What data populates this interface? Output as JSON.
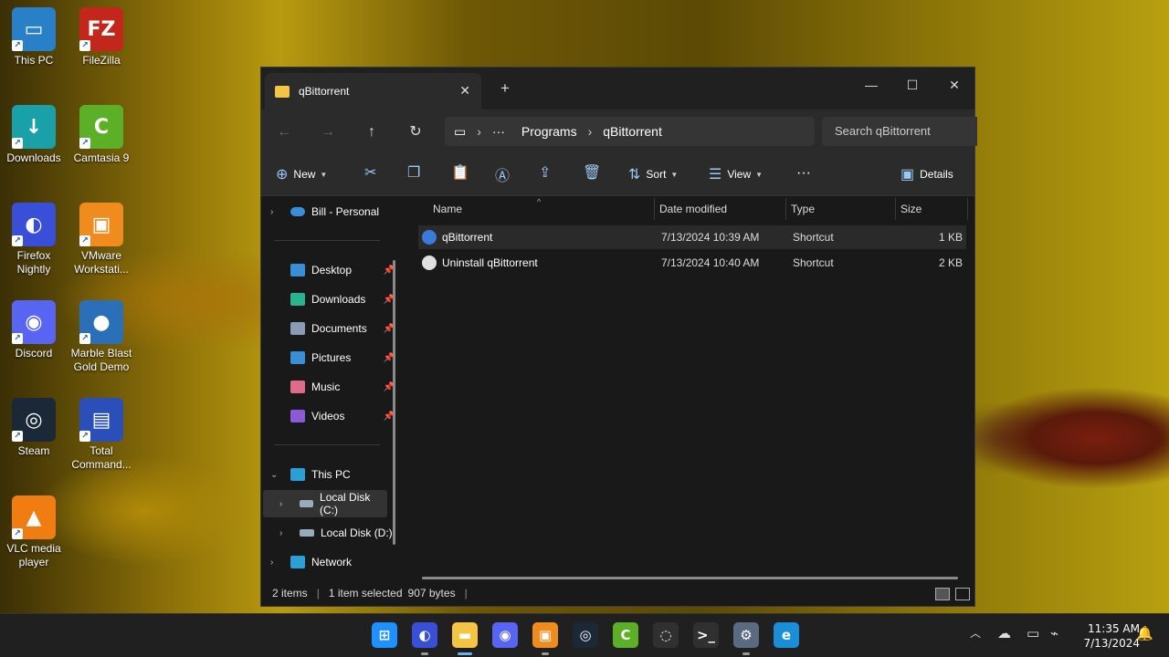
{
  "desktop_icons": [
    {
      "label": "This PC",
      "color": "#2a7fc9",
      "glyph": "▭"
    },
    {
      "label": "FileZilla",
      "color": "#c3271c",
      "glyph": "FZ"
    },
    {
      "label": "Downloads",
      "color": "#1aa0a8",
      "glyph": "↓"
    },
    {
      "label": "Camtasia 9",
      "color": "#5cb027",
      "glyph": "C"
    },
    {
      "label": "Firefox Nightly",
      "color": "#3a4fd8",
      "glyph": "◐"
    },
    {
      "label": "VMware Workstati...",
      "color": "#f08b1e",
      "glyph": "▣"
    },
    {
      "label": "Discord",
      "color": "#5865f2",
      "glyph": "◉"
    },
    {
      "label": "Marble Blast Gold Demo",
      "color": "#2a6fb8",
      "glyph": "●"
    },
    {
      "label": "Steam",
      "color": "#1b2838",
      "glyph": "◎"
    },
    {
      "label": "Total Command...",
      "color": "#2a4fb8",
      "glyph": "▤"
    },
    {
      "label": "VLC media player",
      "color": "#f07c12",
      "glyph": "▲"
    }
  ],
  "window": {
    "tab_title": "qBittorrent",
    "close_tab": "✕",
    "new_tab": "+",
    "min": "—",
    "max": "☐",
    "close": "✕"
  },
  "nav": {
    "back": "←",
    "forward": "→",
    "up": "↑",
    "refresh": "↻",
    "monitor_glyph": "▭",
    "breadcrumb": [
      "Programs",
      "qBittorrent"
    ],
    "search_placeholder": "Search qBittorrent"
  },
  "commands": {
    "new": "New",
    "sort": "Sort",
    "view": "View",
    "more": "···",
    "details": "Details"
  },
  "sidebar": {
    "personal": "Bill - Personal",
    "quick": [
      {
        "label": "Desktop",
        "color": "#3a8ed8"
      },
      {
        "label": "Downloads",
        "color": "#2bb28f"
      },
      {
        "label": "Documents",
        "color": "#8a9bb5"
      },
      {
        "label": "Pictures",
        "color": "#3a8ed8"
      },
      {
        "label": "Music",
        "color": "#e06a8a"
      },
      {
        "label": "Videos",
        "color": "#8a5ad8"
      }
    ],
    "this_pc": "This PC",
    "drives": [
      "Local Disk (C:)",
      "Local Disk (D:)"
    ],
    "network": "Network"
  },
  "columns": {
    "name": "Name",
    "date": "Date modified",
    "type": "Type",
    "size": "Size"
  },
  "files": [
    {
      "name": "qBittorrent",
      "date": "7/13/2024 10:39 AM",
      "type": "Shortcut",
      "size": "1 KB"
    },
    {
      "name": "Uninstall qBittorrent",
      "date": "7/13/2024 10:40 AM",
      "type": "Shortcut",
      "size": "2 KB"
    }
  ],
  "status": {
    "items": "2 items",
    "selected": "1 item selected",
    "bytes": "907 bytes"
  },
  "taskbar": {
    "apps": [
      {
        "name": "start",
        "color": "#1e90ff",
        "glyph": "⊞"
      },
      {
        "name": "firefox",
        "color": "#3a4fd8",
        "glyph": "◐"
      },
      {
        "name": "explorer",
        "color": "#f4c542",
        "glyph": "▬"
      },
      {
        "name": "discord",
        "color": "#5865f2",
        "glyph": "◉"
      },
      {
        "name": "vmware",
        "color": "#f08b1e",
        "glyph": "▣"
      },
      {
        "name": "steam",
        "color": "#1b2838",
        "glyph": "◎"
      },
      {
        "name": "camtasia",
        "color": "#5cb027",
        "glyph": "C"
      },
      {
        "name": "obs",
        "color": "#303030",
        "glyph": "◌"
      },
      {
        "name": "terminal",
        "color": "#303030",
        "glyph": ">_"
      },
      {
        "name": "settings",
        "color": "#5a6a80",
        "glyph": "⚙"
      },
      {
        "name": "edge",
        "color": "#1a8fd8",
        "glyph": "e"
      }
    ],
    "time": "11:35 AM",
    "date": "7/13/2024"
  }
}
